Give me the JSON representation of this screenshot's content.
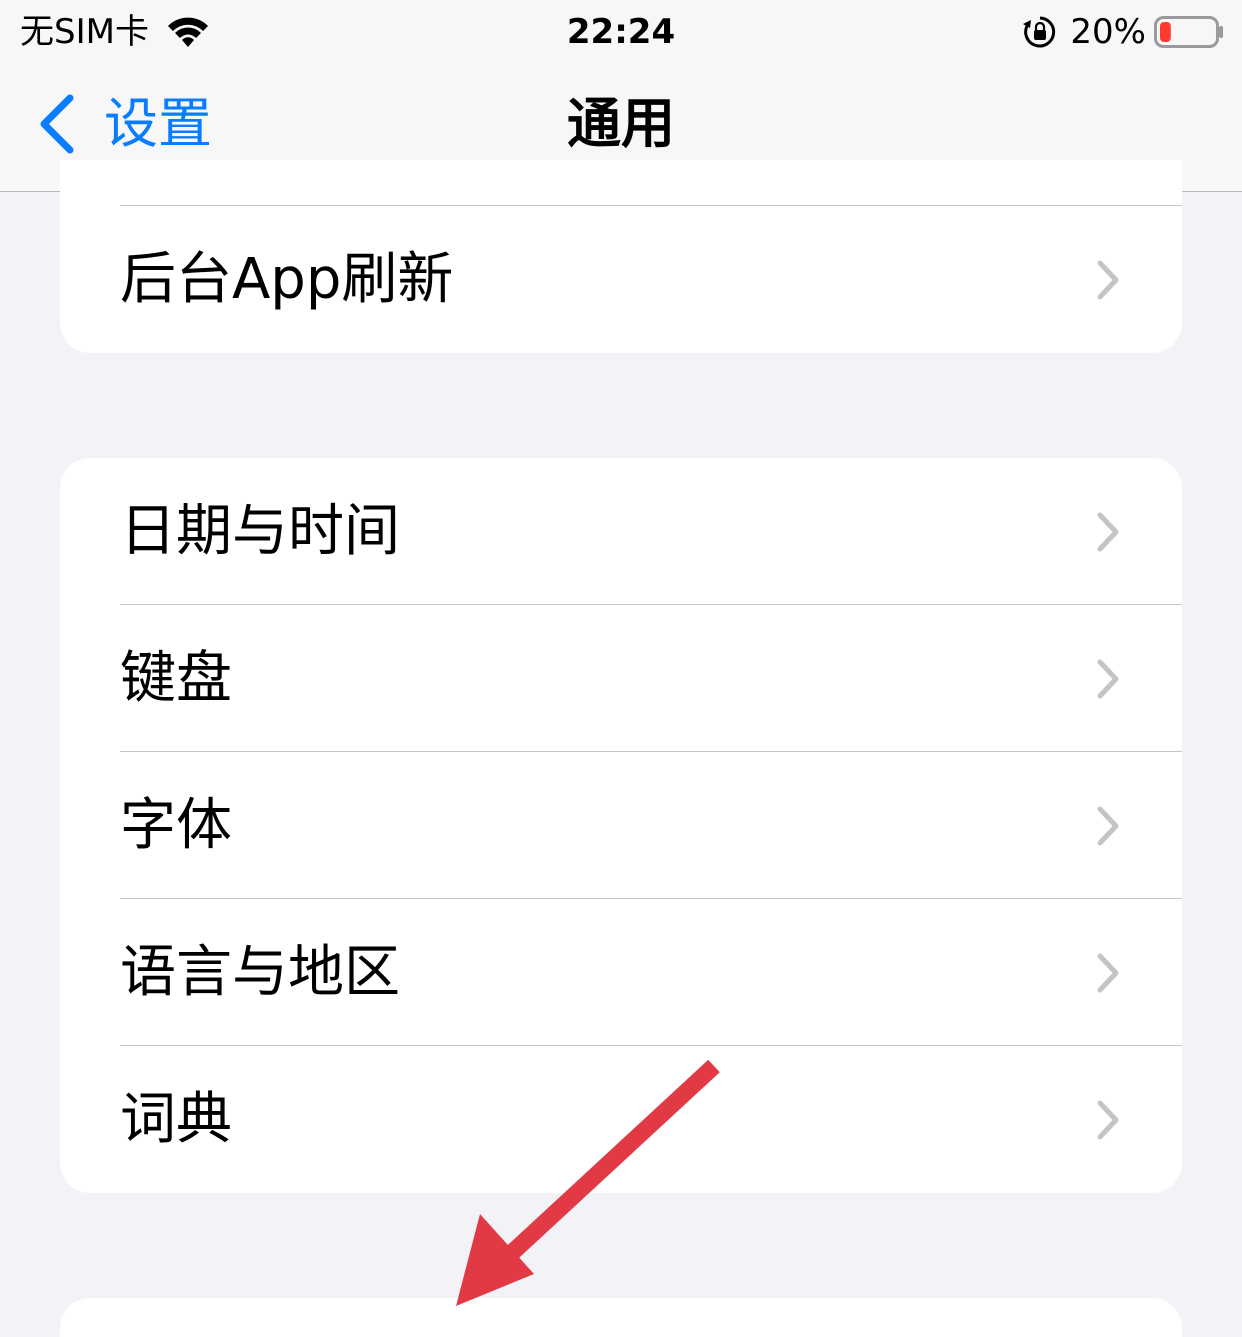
{
  "status_bar": {
    "carrier": "无SIM卡",
    "time": "22:24",
    "battery_percent": "20%",
    "battery_level": 0.2,
    "battery_color": "#ff3b30"
  },
  "nav": {
    "back_label": "设置",
    "title": "通用",
    "accent": "#0a7cff"
  },
  "groups": [
    {
      "items": [
        {
          "label": "后台App刷新"
        }
      ]
    },
    {
      "items": [
        {
          "label": "日期与时间"
        },
        {
          "label": "键盘"
        },
        {
          "label": "字体"
        },
        {
          "label": "语言与地区"
        },
        {
          "label": "词典"
        }
      ]
    }
  ],
  "annotation": {
    "icon": "red-arrow-icon",
    "color": "#e23a45"
  }
}
